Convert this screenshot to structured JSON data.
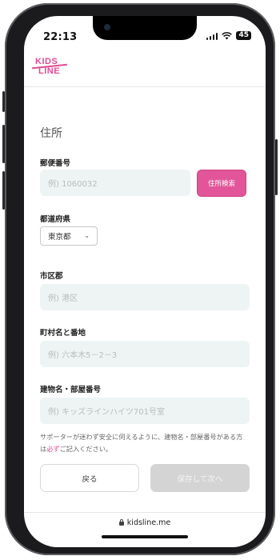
{
  "status_bar": {
    "time": "22:13",
    "battery": "45"
  },
  "logo": {
    "line1": "KIDS",
    "line2": "LINE"
  },
  "form": {
    "title": "住所",
    "postal": {
      "label": "郵便番号",
      "placeholder": "例) 1060032",
      "search_button": "住所検索"
    },
    "prefecture": {
      "label": "都道府県",
      "selected": "東京都"
    },
    "city": {
      "label": "市区郡",
      "placeholder": "例) 港区"
    },
    "town": {
      "label": "町村名と番地",
      "placeholder": "例) 六本木5－2－3"
    },
    "building": {
      "label": "建物名・部屋番号",
      "placeholder": "例) キッズラインハイツ701号室"
    },
    "note_line1": "サポーターが迷わず安全に伺えるように、建物名・部屋番号がある方",
    "note_line2_prefix": "は",
    "note_required": "必ず",
    "note_line2_suffix": "ご記入ください。",
    "back_button": "戻る",
    "next_button": "保存して次へ"
  },
  "browser": {
    "url": "kidsline.me"
  },
  "colors": {
    "accent": "#e2559a",
    "input_bg": "#eef4f4",
    "disabled": "#d4d4d4"
  }
}
